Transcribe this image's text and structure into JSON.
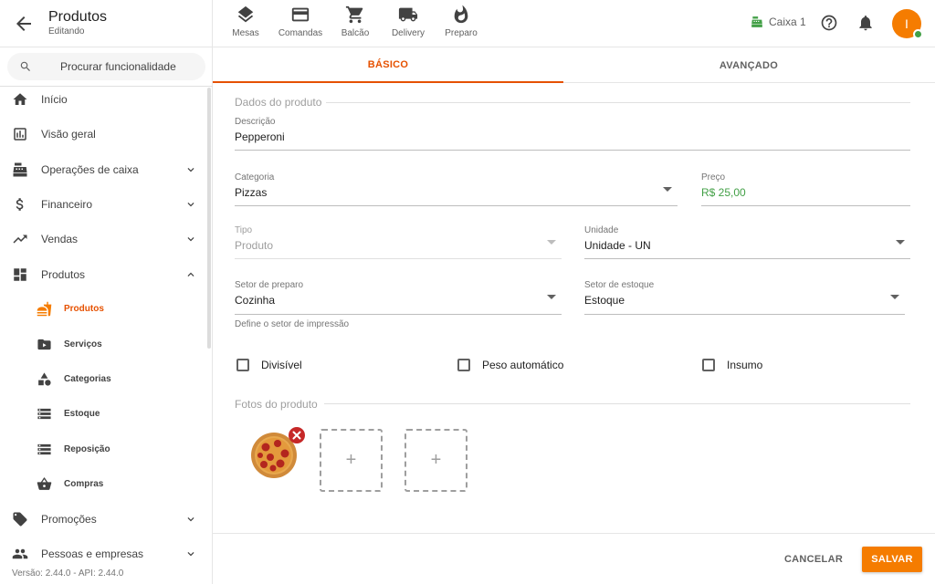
{
  "header": {
    "title": "Produtos",
    "subtitle": "Editando",
    "quick_nav": [
      {
        "label": "Mesas",
        "icon": "layers-icon"
      },
      {
        "label": "Comandas",
        "icon": "card-icon"
      },
      {
        "label": "Balcão",
        "icon": "cart-icon"
      },
      {
        "label": "Delivery",
        "icon": "truck-icon"
      },
      {
        "label": "Preparo",
        "icon": "flame-icon"
      }
    ],
    "register_label": "Caixa 1",
    "avatar_initial": "I"
  },
  "sidebar": {
    "search_placeholder": "Procurar funcionalidade",
    "items": [
      {
        "label": "Início",
        "icon": "home-icon"
      },
      {
        "label": "Visão geral",
        "icon": "chart-icon"
      },
      {
        "label": "Operações de caixa",
        "icon": "cash-register-icon"
      },
      {
        "label": "Financeiro",
        "icon": "dollar-icon"
      },
      {
        "label": "Vendas",
        "icon": "trending-icon"
      },
      {
        "label": "Produtos",
        "icon": "dashboard-icon"
      },
      {
        "label": "Produtos",
        "icon": "food-icon"
      },
      {
        "label": "Serviços",
        "icon": "video-icon"
      },
      {
        "label": "Categorias",
        "icon": "shapes-icon"
      },
      {
        "label": "Estoque",
        "icon": "storage-icon"
      },
      {
        "label": "Reposição",
        "icon": "storage-icon"
      },
      {
        "label": "Compras",
        "icon": "basket-icon"
      },
      {
        "label": "Promoções",
        "icon": "tag-icon"
      },
      {
        "label": "Pessoas e empresas",
        "icon": "people-icon"
      }
    ],
    "version": "Versão: 2.44.0 - API: 2.44.0"
  },
  "tabs": {
    "basic": "BÁSICO",
    "advanced": "AVANÇADO"
  },
  "form": {
    "section_product": "Dados do produto",
    "description_label": "Descrição",
    "description_value": "Pepperoni",
    "category_label": "Categoria",
    "category_value": "Pizzas",
    "price_label": "Preço",
    "price_value": "R$ 25,00",
    "type_label": "Tipo",
    "type_value": "Produto",
    "unit_label": "Unidade",
    "unit_value": "Unidade - UN",
    "prep_label": "Setor de preparo",
    "prep_value": "Cozinha",
    "prep_hint": "Define o setor de impressão",
    "stock_label": "Setor de estoque",
    "stock_value": "Estoque",
    "check_divisible": "Divisível",
    "check_auto_weight": "Peso automático",
    "check_input": "Insumo",
    "section_photos": "Fotos do produto",
    "add_symbol": "+"
  },
  "actions": {
    "cancel": "CANCELAR",
    "save": "SALVAR"
  },
  "colors": {
    "accent": "#f57c00",
    "accent_text": "#e65100",
    "price": "#43a047",
    "remove": "#c62828"
  }
}
